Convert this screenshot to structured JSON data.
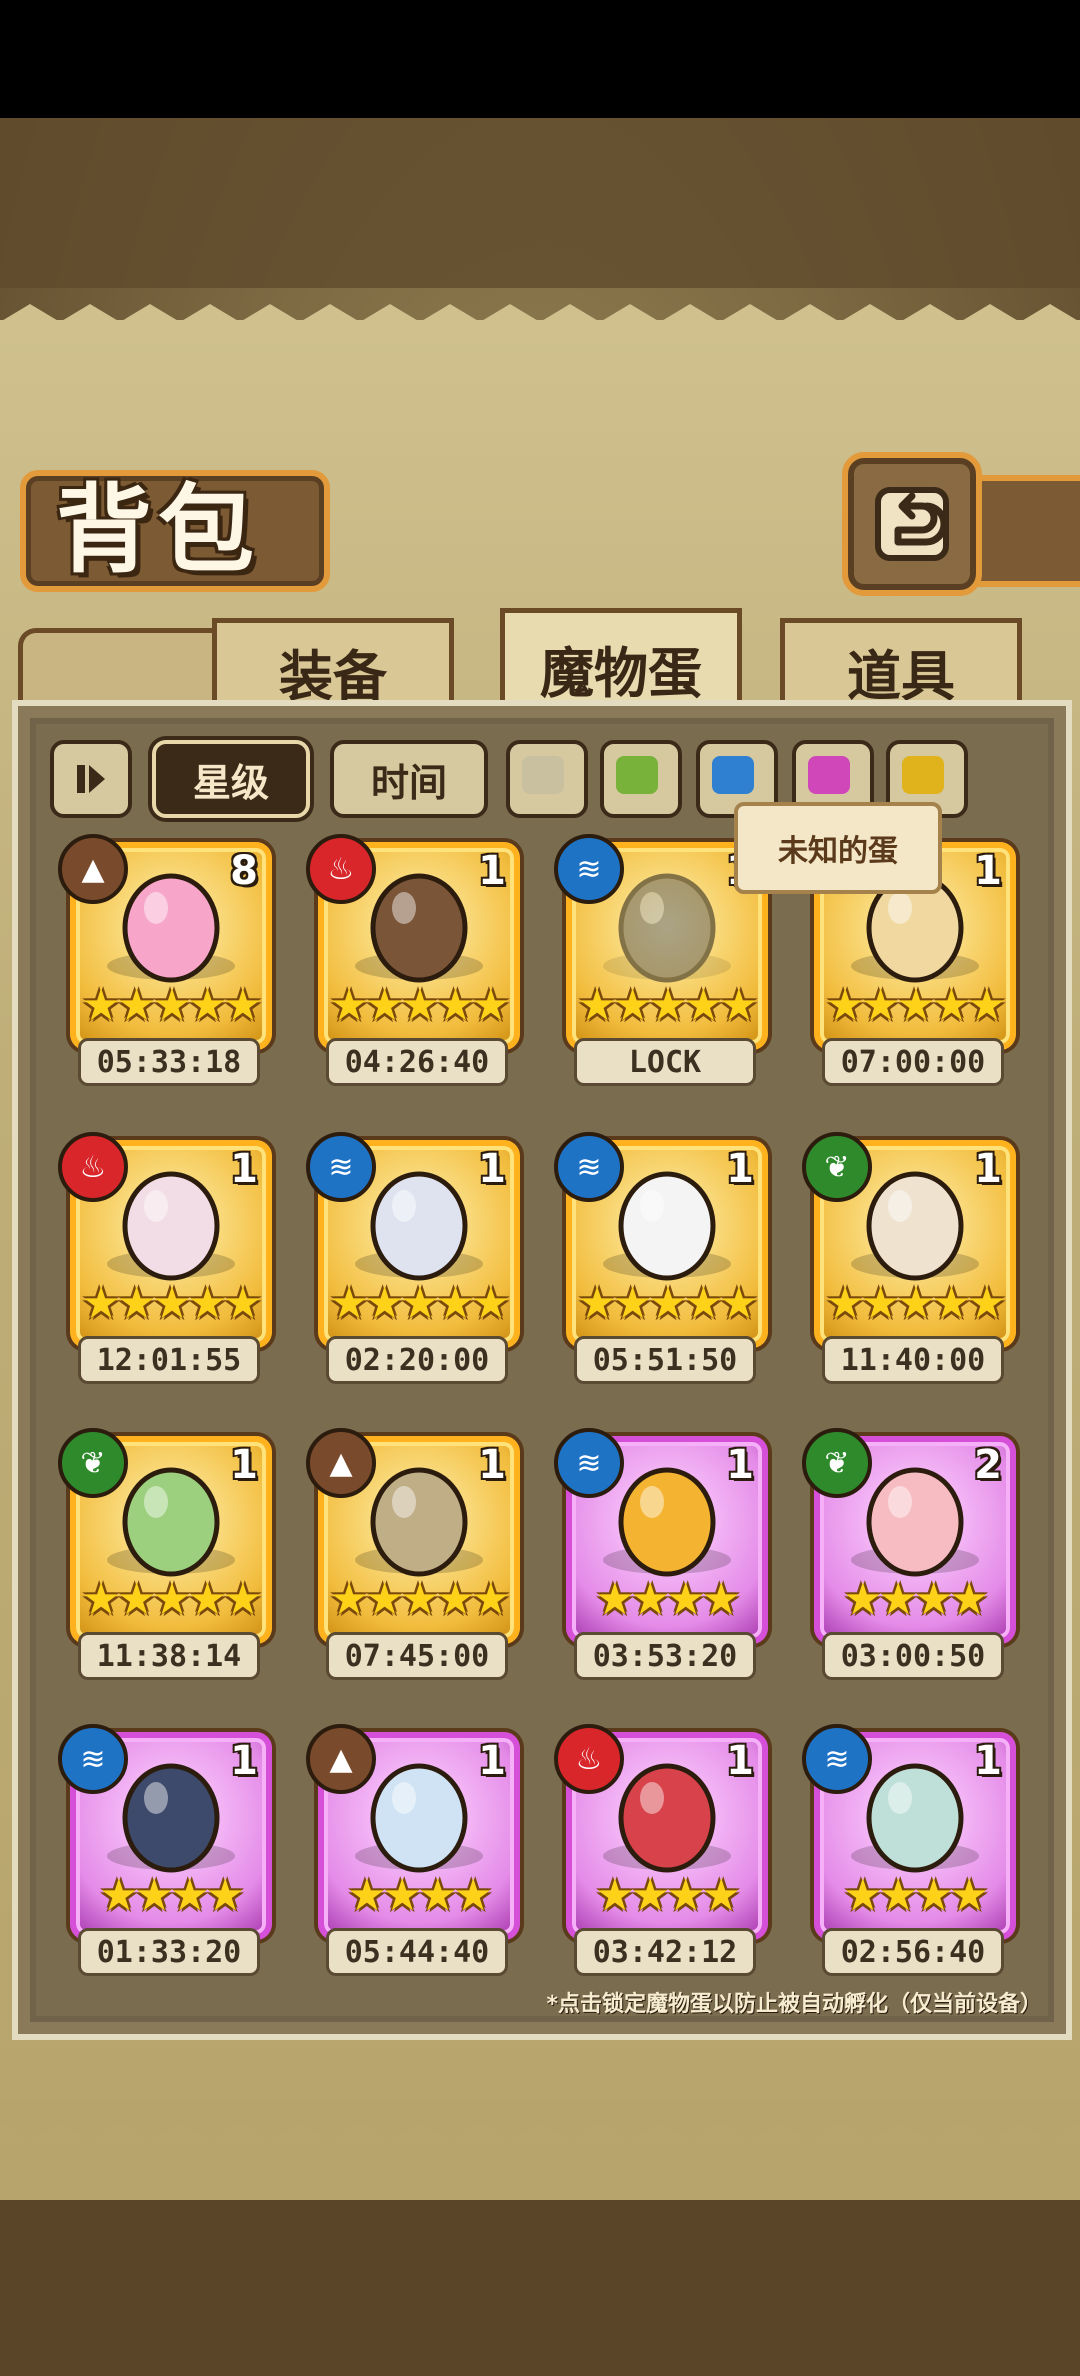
{
  "header": {
    "title": "背包"
  },
  "tabs": [
    {
      "label": "装备",
      "active": false
    },
    {
      "label": "魔物蛋",
      "active": true
    },
    {
      "label": "道具",
      "active": false
    }
  ],
  "filters": {
    "sort_star": "星级",
    "sort_time": "时间",
    "swatch_colors": [
      "#c9c0a0",
      "#78b23a",
      "#2f80d0",
      "#cf47b8",
      "#e0b21c"
    ]
  },
  "tooltip": "未知的蛋",
  "eggs": [
    {
      "element": "earth",
      "count": "8",
      "stars": "★★★★★",
      "timer": "05:33:18",
      "rarity": "gold"
    },
    {
      "element": "fire",
      "count": "1",
      "stars": "★★★★★",
      "timer": "04:26:40",
      "rarity": "gold"
    },
    {
      "element": "water",
      "count": "1",
      "stars": "★★★★★",
      "timer": "LOCK",
      "rarity": "gold"
    },
    {
      "element": "",
      "count": "1",
      "stars": "★★★★★",
      "timer": "07:00:00",
      "rarity": "gold"
    },
    {
      "element": "fire",
      "count": "1",
      "stars": "★★★★★",
      "timer": "12:01:55",
      "rarity": "gold"
    },
    {
      "element": "water",
      "count": "1",
      "stars": "★★★★★",
      "timer": "02:20:00",
      "rarity": "gold"
    },
    {
      "element": "water",
      "count": "1",
      "stars": "★★★★★",
      "timer": "05:51:50",
      "rarity": "gold"
    },
    {
      "element": "grass",
      "count": "1",
      "stars": "★★★★★",
      "timer": "11:40:00",
      "rarity": "gold"
    },
    {
      "element": "grass",
      "count": "1",
      "stars": "★★★★★",
      "timer": "11:38:14",
      "rarity": "gold"
    },
    {
      "element": "earth",
      "count": "1",
      "stars": "★★★★★",
      "timer": "07:45:00",
      "rarity": "gold"
    },
    {
      "element": "water",
      "count": "1",
      "stars": "★★★★",
      "timer": "03:53:20",
      "rarity": "purple"
    },
    {
      "element": "grass",
      "count": "2",
      "stars": "★★★★",
      "timer": "03:00:50",
      "rarity": "purple"
    },
    {
      "element": "water",
      "count": "1",
      "stars": "★★★★",
      "timer": "01:33:20",
      "rarity": "purple"
    },
    {
      "element": "earth",
      "count": "1",
      "stars": "★★★★",
      "timer": "05:44:40",
      "rarity": "purple"
    },
    {
      "element": "fire",
      "count": "1",
      "stars": "★★★★",
      "timer": "03:42:12",
      "rarity": "purple"
    },
    {
      "element": "water",
      "count": "1",
      "stars": "★★★★",
      "timer": "02:56:40",
      "rarity": "purple"
    }
  ],
  "footnote": "*点击锁定魔物蛋以防止被自动孵化（仅当前设备）"
}
